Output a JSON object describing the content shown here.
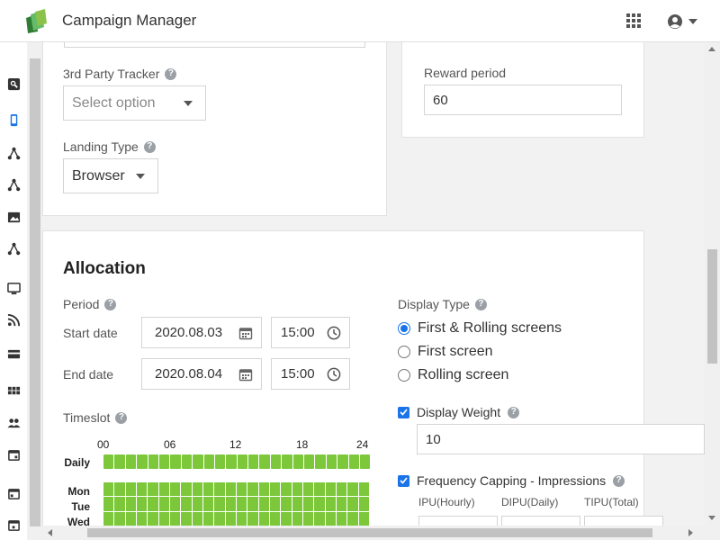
{
  "app": {
    "title": "Campaign Manager"
  },
  "colors": {
    "accent": "#1a73e8",
    "timeslot_on": "#7dc83a"
  },
  "nav": [
    "analytics-icon",
    "mobile-icon",
    "network-icon",
    "network-icon",
    "image-icon",
    "network-icon",
    "monitor-icon",
    "rss-icon",
    "card-icon",
    "apps-icon",
    "people-icon",
    "calendar-icon",
    "calendar-icon",
    "calendar-icon"
  ],
  "tracker": {
    "label": "3rd Party Tracker",
    "placeholder": "Select option",
    "help": "?"
  },
  "landing": {
    "label": "Landing Type",
    "value": "Browser",
    "help": "?"
  },
  "reward": {
    "label": "Reward period",
    "value": "60"
  },
  "allocation": {
    "title": "Allocation",
    "period_label": "Period",
    "start_label": "Start date",
    "start_date": "2020.08.03",
    "start_time": "15:00",
    "end_label": "End date",
    "end_date": "2020.08.04",
    "end_time": "15:00",
    "timeslot_label": "Timeslot",
    "hours": [
      "00",
      "06",
      "12",
      "18",
      "24"
    ],
    "days": [
      "Daily",
      "Mon",
      "Tue",
      "Wed"
    ],
    "help": "?"
  },
  "display": {
    "type_label": "Display Type",
    "options": [
      "First & Rolling screens",
      "First screen",
      "Rolling screen"
    ],
    "selected": "First & Rolling screens",
    "weight_label": "Display Weight",
    "weight_checked": true,
    "weight_value": "10",
    "freq_label": "Frequency Capping - Impressions",
    "freq_checked": true,
    "freq_cols": [
      "IPU(Hourly)",
      "DIPU(Daily)",
      "TIPU(Total)"
    ],
    "help": "?"
  }
}
